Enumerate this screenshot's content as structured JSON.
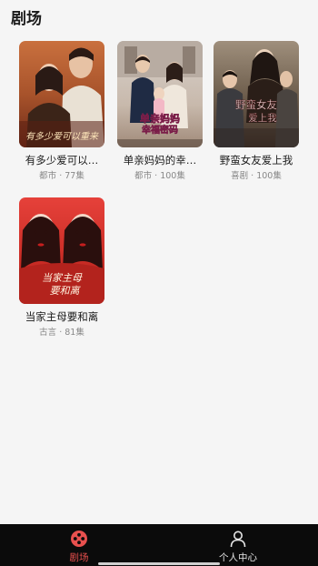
{
  "header": {
    "title": "剧场"
  },
  "dramas": [
    {
      "title": "有多少爱可以…",
      "meta": "都市 · 77集",
      "poster_text": "有多少爱可以重来"
    },
    {
      "title": "单亲妈妈的幸…",
      "meta": "都市 · 100集",
      "poster_text": "单亲妈妈幸福密码"
    },
    {
      "title": "野蛮女友爱上我",
      "meta": "喜剧 · 100集",
      "poster_text": "野蛮女友爱上我"
    },
    {
      "title": "当家主母要和离",
      "meta": "古言 · 81集",
      "poster_text": "当家主母要和离"
    }
  ],
  "tabbar": {
    "tabs": [
      {
        "label": "剧场",
        "icon": "theater-icon",
        "active": true
      },
      {
        "label": "个人中心",
        "icon": "user-icon",
        "active": false
      }
    ]
  },
  "colors": {
    "accent": "#e8504e",
    "tabbar_bg": "#0b0b0b",
    "page_bg": "#f5f5f5"
  }
}
